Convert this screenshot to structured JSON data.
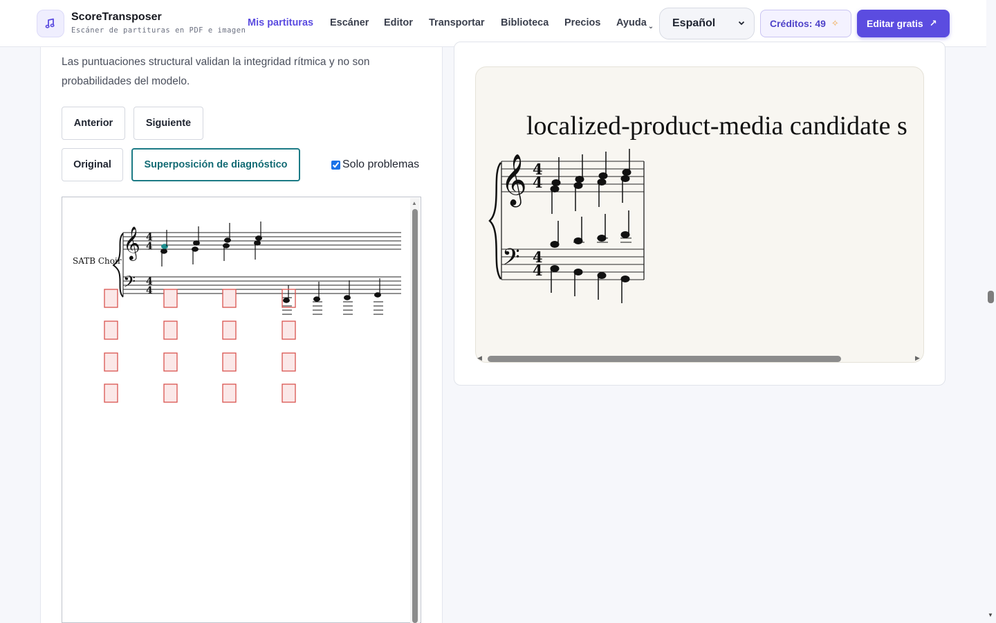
{
  "header": {
    "brand_name": "ScoreTransposer",
    "brand_subtitle": "Escáner de partituras en PDF e imagen",
    "nav": [
      {
        "label": "Mis partituras",
        "active": true
      },
      {
        "label": "Escáner"
      },
      {
        "label": "Editor"
      },
      {
        "label": "Transportar"
      },
      {
        "label": "Biblioteca"
      },
      {
        "label": "Precios"
      },
      {
        "label": "Ayuda",
        "has_dropdown": true
      }
    ],
    "language": "Español",
    "credits_label": "Créditos: 49",
    "cta_label": "Editar gratis",
    "colors": {
      "accent": "#5b4ce0",
      "teal": "#1b7a85",
      "issue": "#d9534f"
    }
  },
  "left": {
    "info_text": "Las puntuaciones structural validan la integridad rítmica y no son probabilidades del modelo.",
    "prev_label": "Anterior",
    "next_label": "Siguiente",
    "view_original_label": "Original",
    "view_overlay_label": "Superposición de diagnóstico",
    "only_problems_label": "Solo problemas",
    "only_problems_checked": true,
    "overlay": {
      "instrument_label": "SATB Choir",
      "time_signature": "4/4"
    }
  },
  "right": {
    "score_title": "localized-product-media candidate s",
    "time_signature": "4/4"
  }
}
